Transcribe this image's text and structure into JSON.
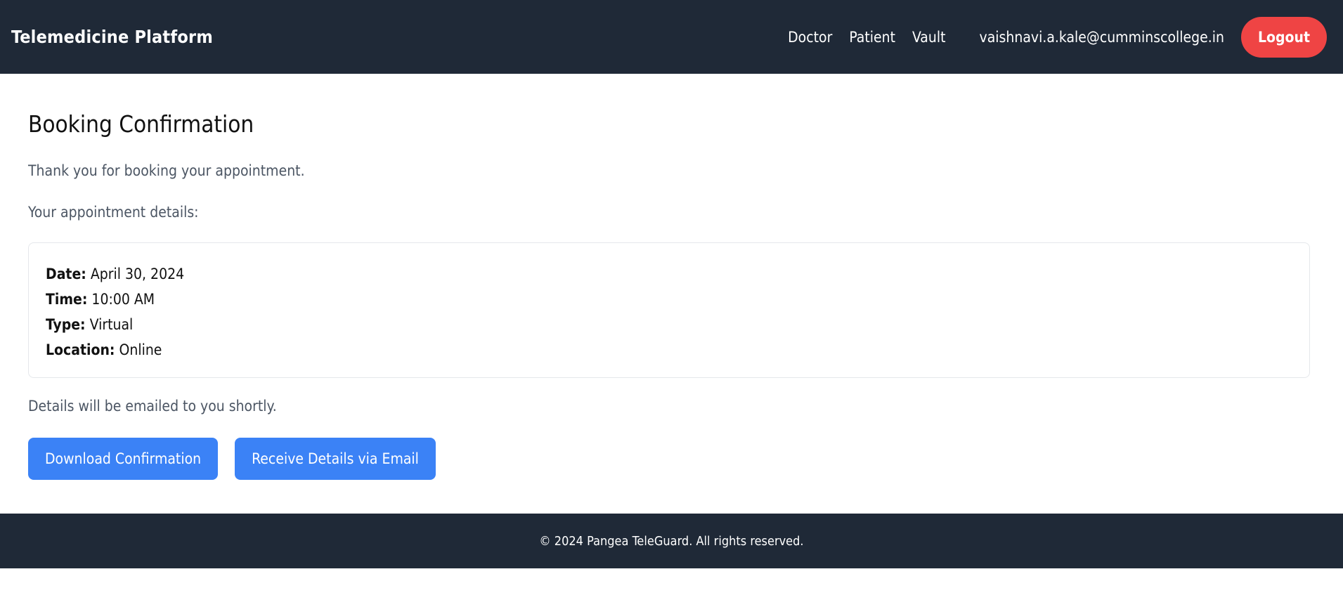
{
  "header": {
    "title": "Telemedicine Platform",
    "nav": [
      {
        "label": "Doctor"
      },
      {
        "label": "Patient"
      },
      {
        "label": "Vault"
      }
    ],
    "user_email": "vaishnavi.a.kale@cumminscollege.in",
    "logout_label": "Logout"
  },
  "main": {
    "title": "Booking Confirmation",
    "thank_you": "Thank you for booking your appointment.",
    "details_label": "Your appointment details:",
    "details": [
      {
        "key": "Date:",
        "value": "April 30, 2024"
      },
      {
        "key": "Time:",
        "value": "10:00 AM"
      },
      {
        "key": "Type:",
        "value": "Virtual"
      },
      {
        "key": "Location:",
        "value": "Online"
      }
    ],
    "email_note": "Details will be emailed to you shortly.",
    "actions": {
      "download_label": "Download Confirmation",
      "email_label": "Receive Details via Email"
    }
  },
  "footer": {
    "text": "© 2024 Pangea TeleGuard. All rights reserved."
  },
  "colors": {
    "header_bg": "#1f2937",
    "logout_red": "#ef4444",
    "primary_blue": "#3b82f6",
    "muted_text": "#4b5563"
  }
}
